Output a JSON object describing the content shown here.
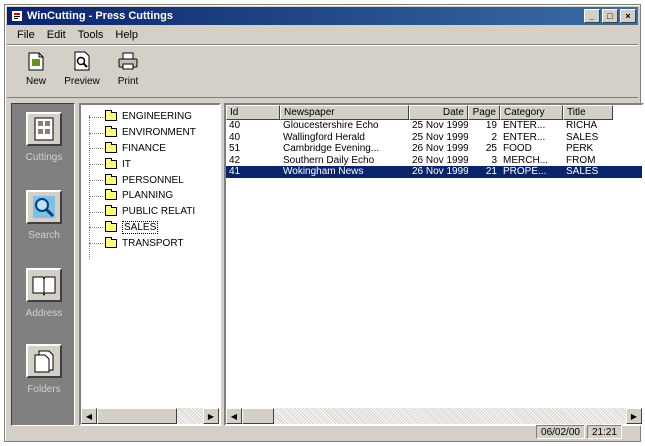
{
  "window": {
    "title": "WinCutting - Press Cuttings"
  },
  "menu": [
    "File",
    "Edit",
    "Tools",
    "Help"
  ],
  "toolbar": [
    {
      "label": "New",
      "icon": "new-document-icon"
    },
    {
      "label": "Preview",
      "icon": "print-preview-icon"
    },
    {
      "label": "Print",
      "icon": "printer-icon"
    }
  ],
  "leftbar": [
    {
      "label": "Cuttings",
      "icon": "cuttings-icon"
    },
    {
      "label": "Search",
      "icon": "search-icon"
    },
    {
      "label": "Address",
      "icon": "address-book-icon"
    },
    {
      "label": "Folders",
      "icon": "folders-icon"
    }
  ],
  "tree": {
    "items": [
      "ENGINEERING",
      "ENVIRONMENT",
      "FINANCE",
      "IT",
      "PERSONNEL",
      "PLANNING",
      "PUBLIC RELATI",
      "SALES",
      "TRANSPORT"
    ],
    "selected": 7
  },
  "list": {
    "columns": [
      "Id",
      "Newspaper",
      "Date",
      "Page",
      "Category",
      "Title"
    ],
    "rows": [
      [
        "40",
        "Gloucestershire Echo",
        "25 Nov 1999",
        "19",
        "ENTER...",
        "RICHA"
      ],
      [
        "40",
        "Wallingford Herald",
        "25 Nov 1999",
        "2",
        "ENTER...",
        "SALES"
      ],
      [
        "51",
        "Cambridge Evening...",
        "26 Nov 1999",
        "25",
        "FOOD",
        "PERK"
      ],
      [
        "42",
        "Southern Daily Echo",
        "26 Nov 1999",
        "3",
        "MERCH...",
        "FROM"
      ],
      [
        "41",
        "Wokingham News",
        "26 Nov 1999",
        "21",
        "PROPE...",
        "SALES"
      ]
    ],
    "selected": 4
  },
  "status": {
    "date": "06/02/00",
    "time": "21:21"
  }
}
